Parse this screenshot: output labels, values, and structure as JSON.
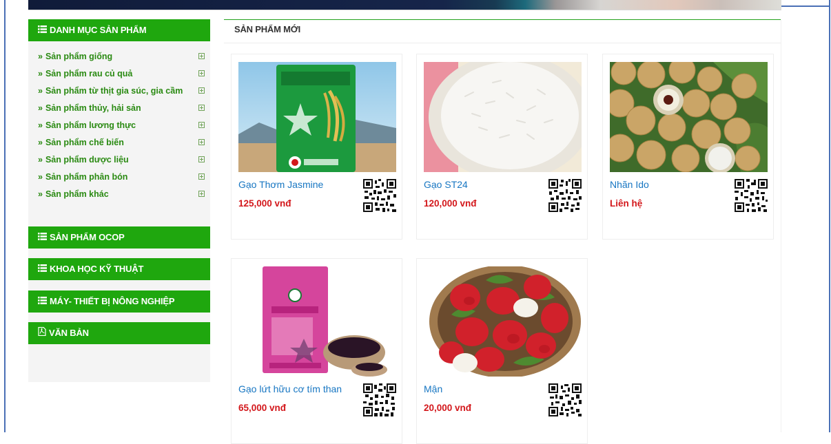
{
  "sidebar": {
    "category_heading": "DANH MỤC SẢN PHẨM",
    "categories": [
      "Sản phẩm giống",
      "Sản phẩm rau củ quả",
      "Sản phẩm từ thịt gia súc, gia cầm",
      "Sản phẩm thủy, hải sản",
      "Sản phẩm lương thực",
      "Sản phẩm chế biến",
      "Sản phẩm dược liệu",
      "Sản phẩm phân bón",
      "Sản phẩm khác"
    ],
    "chevron": "»",
    "sections": [
      "SẢN PHẨM OCOP",
      "KHOA HỌC KỸ THUẬT",
      "MÁY- THIẾT BỊ NÔNG NGHIỆP",
      "VĂN BẢN"
    ]
  },
  "main": {
    "title": "SẢN PHẨM MỚI",
    "products": [
      {
        "name": "Gạo Thơm Jasmine",
        "price": "125,000 vnđ",
        "image": "rice-bag-green"
      },
      {
        "name": "Gạo ST24",
        "price": "120,000 vnđ",
        "image": "white-rice-bowl"
      },
      {
        "name": "Nhãn Ido",
        "price": "Liên hệ",
        "image": "longan-fruit"
      },
      {
        "name": "Gạo lứt hữu cơ tím than",
        "price": "65,000 vnđ",
        "image": "brown-rice-bag-pink"
      },
      {
        "name": "Mận",
        "price": "20,000 vnđ",
        "image": "rose-apple-basket"
      }
    ]
  },
  "colors": {
    "brand_green": "#1fa70e",
    "link_green": "#2a8a12",
    "product_link": "#1776c2",
    "price_red": "#d3171b"
  },
  "icons": {
    "list": "list-icon",
    "document": "pdf-document-icon",
    "expand": "plus-box-icon",
    "qr": "qr-code-icon"
  }
}
